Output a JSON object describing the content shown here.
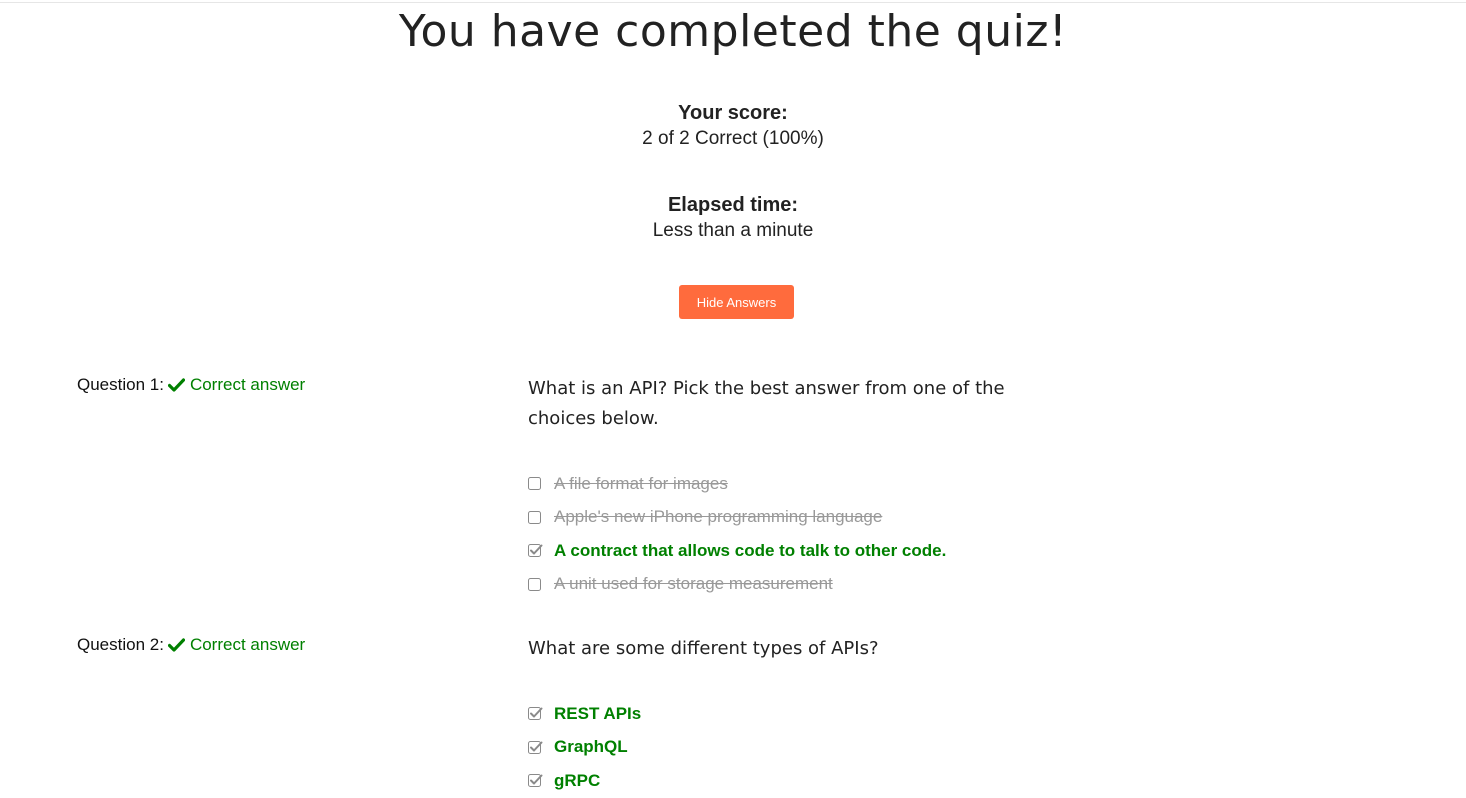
{
  "title": "You have completed the quiz!",
  "score": {
    "label": "Your score:",
    "value": "2 of 2 Correct (100%)"
  },
  "elapsed": {
    "label": "Elapsed time:",
    "value": "Less than a minute"
  },
  "toggle_button": "Hide Answers",
  "questions": [
    {
      "prefix": "Question 1:",
      "status": "Correct answer",
      "text": "What is an API? Pick the best answer from one of the choices below.",
      "choices": [
        {
          "label": "A file format for images",
          "selected": false,
          "correct": false
        },
        {
          "label": "Apple's new iPhone programming language",
          "selected": false,
          "correct": false
        },
        {
          "label": "A contract that allows code to talk to other code.",
          "selected": true,
          "correct": true
        },
        {
          "label": "A unit used for storage measurement",
          "selected": false,
          "correct": false
        }
      ]
    },
    {
      "prefix": "Question 2:",
      "status": "Correct answer",
      "text": "What are some different types of APIs?",
      "choices": [
        {
          "label": "REST APIs",
          "selected": true,
          "correct": true
        },
        {
          "label": "GraphQL",
          "selected": true,
          "correct": true
        },
        {
          "label": "gRPC",
          "selected": true,
          "correct": true
        }
      ]
    }
  ],
  "colors": {
    "correct": "#008000",
    "button": "#ff6b3d",
    "struck": "#999999"
  },
  "icons": {
    "status": "checkmark-icon",
    "unchecked": "checkbox-empty-icon",
    "checked": "checkbox-checked-icon"
  }
}
